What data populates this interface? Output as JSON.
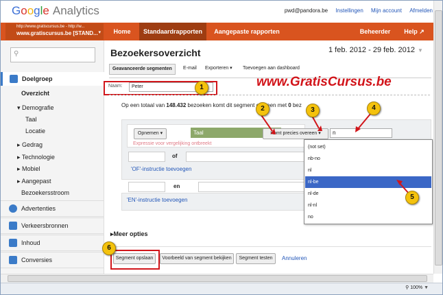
{
  "header": {
    "logo_google": [
      "G",
      "o",
      "o",
      "g",
      "l",
      "e"
    ],
    "logo_analytics": "Analytics",
    "user_email": "pwd@pandora.be",
    "links": [
      "Instellingen",
      "Mijn account",
      "Afmelden"
    ]
  },
  "account": {
    "url_line": "http://www.gratiscursus.be - http://w...",
    "name_line": "www.gratiscursus.be [STAND...",
    "arrow": "▾"
  },
  "nav": {
    "home": "Home",
    "standard": "Standaardrapporten",
    "custom": "Aangepaste rapporten",
    "admin": "Beheerder",
    "help": "Help ↗"
  },
  "sidebar": {
    "search_icon": "search-icon",
    "doelgroep": "Doelgroep",
    "items": [
      {
        "label": "Overzicht",
        "bold": true
      },
      {
        "label": "▾ Demografie"
      },
      {
        "label": "Taal"
      },
      {
        "label": "Locatie"
      },
      {
        "label": "▸ Gedrag"
      },
      {
        "label": "▸ Technologie"
      },
      {
        "label": "▸ Mobiel"
      },
      {
        "label": "▸ Aangepast"
      },
      {
        "label": "Bezoekersstroom"
      }
    ],
    "sections": [
      "Advertenties",
      "Verkeersbronnen",
      "Inhoud",
      "Conversies"
    ]
  },
  "main": {
    "title": "Bezoekersoverzicht",
    "date_range": "1 feb. 2012 - 29 feb. 2012",
    "tabs": [
      "Geavanceerde segmenten",
      "E-mail",
      "Exporteren ▾",
      "Toevoegen aan dashboard"
    ],
    "naam_label": "Naam:",
    "naam_value": "Peter",
    "summary_prefix": "Op een totaal van ",
    "summary_total": "148.432",
    "summary_mid": " bezoeken komt dit segment overeen met ",
    "summary_count": "0",
    "summary_suffix": " bez"
  },
  "segment": {
    "opnemen": "Opnemen ▾",
    "dimension": "Taal",
    "condition": "Komt precies overeen ▾",
    "value": "n",
    "error": "Expressie voor vergelijking ontbreekt",
    "of": "of",
    "or_link": "'OF'-instructie toevoegen",
    "en": "en",
    "and_link": "'EN'-instructie toevoegen"
  },
  "dropdown": {
    "options": [
      "(not set)",
      "nb-no",
      "nl",
      "nl-be",
      "nl-de",
      "nl-nl",
      "no"
    ],
    "highlighted": "nl-be"
  },
  "footer": {
    "meer": "Meer opties",
    "save": "Segment opslaan",
    "preview": "Voorbeeld van segment bekijken",
    "test": "Segment testen",
    "cancel": "Annuleren"
  },
  "watermark": "www.GratisCursus.be",
  "badges": [
    "1",
    "2",
    "3",
    "4",
    "5",
    "6"
  ],
  "statusbar": {
    "zoom": "100%"
  },
  "colors": {
    "nav": "#d9541f",
    "nav_active": "#9e3d12",
    "callout_border": "#d1151a",
    "badge": "#f4c20d",
    "highlight": "#3b67c6"
  }
}
